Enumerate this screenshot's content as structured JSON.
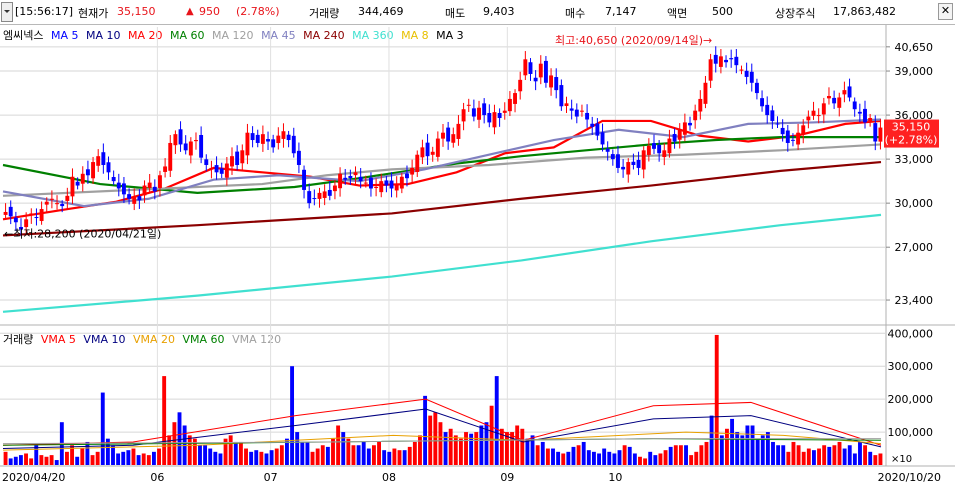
{
  "header": {
    "time": "[15:56:17]",
    "price_label": "현재가",
    "price": "35,150",
    "change_icon": "up-triangle-icon",
    "change_arrow": "▲",
    "change": "950",
    "change_pct": "(2.78%)",
    "volume_label": "거래량",
    "volume": "344,469",
    "sell_label": "매도",
    "sell": "9,403",
    "buy_label": "매수",
    "buy": "7,147",
    "face_label": "액면",
    "face": "500",
    "listed_label": "상장주식",
    "listed": "17,863,482"
  },
  "price_legend": {
    "name": "엠씨넥스",
    "items": [
      {
        "label": "MA 5",
        "color": "#0000ff"
      },
      {
        "label": "MA 10",
        "color": "#000080"
      },
      {
        "label": "MA 20",
        "color": "#ff0000"
      },
      {
        "label": "MA 60",
        "color": "#008000"
      },
      {
        "label": "MA 120",
        "color": "#a0a0a0"
      },
      {
        "label": "MA 45",
        "color": "#8080c0"
      },
      {
        "label": "MA 240",
        "color": "#8b0000"
      },
      {
        "label": "MA 360",
        "color": "#40e0d0"
      },
      {
        "label": "MA 8",
        "color": "#e8c000"
      },
      {
        "label": "MA 3",
        "color": "#000000"
      }
    ]
  },
  "volume_legend": {
    "name": "거래량",
    "items": [
      {
        "label": "VMA 5",
        "color": "#ff0000"
      },
      {
        "label": "VMA 10",
        "color": "#000080"
      },
      {
        "label": "VMA 20",
        "color": "#e8a000"
      },
      {
        "label": "VMA 60",
        "color": "#008000"
      },
      {
        "label": "VMA 120",
        "color": "#a0a0a0"
      }
    ]
  },
  "annotations": {
    "high": "최고:40,650 (2020/09/14일)→",
    "low": "←최저:28,200 (2020/04/21일)",
    "last_price": "35,150",
    "last_pct": "(+2.78%)",
    "vol_unit": "×10"
  },
  "chart_data": [
    {
      "type": "candlestick",
      "title": "엠씨넥스",
      "y_ticks": [
        40650,
        39000,
        36000,
        33000,
        30000,
        27000,
        23400
      ],
      "ylim": [
        21700,
        42000
      ],
      "x_ticks": [
        "2020/04/20",
        "06",
        "07",
        "08",
        "09",
        "10",
        "2020/10/20"
      ],
      "high": 40650,
      "low": 28200,
      "last": 35150,
      "close_series": [
        29400,
        29100,
        28700,
        28200,
        28900,
        29300,
        29000,
        29600,
        30100,
        30300,
        30000,
        29800,
        30500,
        31800,
        31200,
        32000,
        31900,
        32800,
        33200,
        32600,
        32100,
        31500,
        31000,
        30600,
        30300,
        30400,
        30200,
        31200,
        31400,
        30800,
        31900,
        32500,
        34100,
        34700,
        34000,
        33600,
        34200,
        34300,
        33100,
        32600,
        32400,
        32100,
        32000,
        32700,
        33200,
        32600,
        33600,
        34800,
        34300,
        34100,
        34700,
        34200,
        33800,
        34600,
        34900,
        34300,
        33400,
        32600,
        30900,
        30000,
        30300,
        30700,
        30800,
        30500,
        31200,
        32000,
        31600,
        31700,
        32100,
        31500,
        31400,
        31000,
        31100,
        31500,
        31200,
        31000,
        31300,
        31800,
        31700,
        32400,
        33300,
        33800,
        33200,
        33500,
        34400,
        34800,
        34200,
        34700,
        35400,
        36400,
        36700,
        35900,
        36500,
        36000,
        35500,
        36200,
        35800,
        36300,
        37100,
        37500,
        38400,
        39800,
        38800,
        38300,
        39500,
        38200,
        38700,
        37700,
        36600,
        36800,
        36300,
        35900,
        36300,
        35700,
        35200,
        34600,
        34000,
        33500,
        33000,
        32400,
        32300,
        32800,
        32600,
        32400,
        33600,
        33900,
        33700,
        33400,
        33600,
        34400,
        34200,
        35000,
        35500,
        35300,
        36300,
        37100,
        38200,
        39800,
        39500,
        40000,
        39600,
        39800,
        39400,
        39100,
        38600,
        38200,
        37500,
        36600,
        36000,
        35600,
        35400,
        34700,
        34100,
        34300,
        34800,
        35300,
        35900,
        36300,
        36000,
        36800,
        37300,
        36800,
        37200,
        37700,
        37200,
        36400,
        36100,
        35500,
        35800,
        34200,
        35150
      ],
      "ma": [
        {
          "name": "MA 20",
          "color": "#ff0000",
          "points": [
            [
              0,
              28900
            ],
            [
              20,
              29600
            ],
            [
              35,
              30100
            ],
            [
              50,
              31000
            ],
            [
              65,
              32400
            ],
            [
              80,
              32100
            ],
            [
              95,
              31800
            ],
            [
              110,
              31200
            ],
            [
              125,
              31300
            ],
            [
              140,
              32100
            ],
            [
              155,
              33400
            ],
            [
              170,
              33800
            ],
            [
              185,
              35600
            ],
            [
              200,
              35600
            ],
            [
              215,
              34600
            ],
            [
              230,
              34200
            ],
            [
              245,
              34600
            ],
            [
              260,
              35400
            ],
            [
              271,
              35600
            ]
          ]
        },
        {
          "name": "MA 60",
          "color": "#008000",
          "points": [
            [
              0,
              32600
            ],
            [
              30,
              31300
            ],
            [
              60,
              30700
            ],
            [
              90,
              31100
            ],
            [
              110,
              31700
            ],
            [
              125,
              32200
            ],
            [
              140,
              32700
            ],
            [
              160,
              33200
            ],
            [
              180,
              33600
            ],
            [
              200,
              34000
            ],
            [
              220,
              34300
            ],
            [
              240,
              34500
            ],
            [
              271,
              34500
            ]
          ]
        },
        {
          "name": "MA 120",
          "color": "#a0a0a0",
          "points": [
            [
              0,
              30500
            ],
            [
              40,
              30900
            ],
            [
              80,
              31300
            ],
            [
              100,
              31900
            ],
            [
              120,
              32300
            ],
            [
              150,
              32600
            ],
            [
              180,
              33100
            ],
            [
              210,
              33300
            ],
            [
              240,
              33600
            ],
            [
              271,
              34000
            ]
          ]
        },
        {
          "name": "MA 45",
          "color": "#8080c0",
          "points": [
            [
              0,
              30800
            ],
            [
              25,
              29800
            ],
            [
              45,
              30300
            ],
            [
              65,
              31600
            ],
            [
              85,
              31900
            ],
            [
              110,
              31500
            ],
            [
              130,
              32300
            ],
            [
              150,
              33300
            ],
            [
              170,
              34300
            ],
            [
              190,
              35000
            ],
            [
              210,
              34500
            ],
            [
              230,
              35400
            ],
            [
              250,
              35500
            ],
            [
              271,
              35700
            ]
          ]
        },
        {
          "name": "MA 240",
          "color": "#8b0000",
          "points": [
            [
              0,
              27800
            ],
            [
              60,
              28500
            ],
            [
              120,
              29300
            ],
            [
              160,
              30300
            ],
            [
              200,
              31200
            ],
            [
              240,
              32200
            ],
            [
              271,
              32800
            ]
          ]
        },
        {
          "name": "MA 360",
          "color": "#40e0d0",
          "points": [
            [
              0,
              22600
            ],
            [
              60,
              23700
            ],
            [
              120,
              25000
            ],
            [
              160,
              26100
            ],
            [
              200,
              27400
            ],
            [
              240,
              28500
            ],
            [
              271,
              29200
            ]
          ]
        }
      ]
    },
    {
      "type": "bar",
      "title": "거래량",
      "y_ticks": [
        400000,
        300000,
        200000,
        100000
      ],
      "ylim": [
        0,
        410000
      ],
      "unit": "×10",
      "values": [
        40000,
        20000,
        25000,
        30000,
        35000,
        20000,
        60000,
        30000,
        25000,
        30000,
        15000,
        130000,
        40000,
        60000,
        25000,
        50000,
        70000,
        30000,
        40000,
        220000,
        80000,
        60000,
        35000,
        40000,
        45000,
        50000,
        30000,
        35000,
        30000,
        40000,
        50000,
        270000,
        90000,
        130000,
        160000,
        120000,
        90000,
        80000,
        60000,
        60000,
        50000,
        40000,
        35000,
        80000,
        90000,
        70000,
        70000,
        50000,
        40000,
        45000,
        40000,
        35000,
        45000,
        50000,
        60000,
        80000,
        300000,
        100000,
        70000,
        70000,
        40000,
        50000,
        60000,
        55000,
        80000,
        120000,
        100000,
        80000,
        60000,
        60000,
        70000,
        50000,
        60000,
        70000,
        45000,
        40000,
        50000,
        45000,
        45000,
        55000,
        70000,
        90000,
        210000,
        150000,
        160000,
        130000,
        100000,
        110000,
        90000,
        80000,
        100000,
        95000,
        100000,
        120000,
        130000,
        180000,
        270000,
        110000,
        100000,
        100000,
        120000,
        110000,
        80000,
        90000,
        60000,
        70000,
        50000,
        50000,
        40000,
        35000,
        40000,
        55000,
        60000,
        70000,
        45000,
        40000,
        35000,
        50000,
        40000,
        35000,
        45000,
        60000,
        55000,
        35000,
        25000,
        20000,
        40000,
        30000,
        35000,
        45000,
        55000,
        60000,
        60000,
        60000,
        30000,
        40000,
        60000,
        70000,
        150000,
        395000,
        90000,
        110000,
        140000,
        100000,
        90000,
        120000,
        120000,
        80000,
        90000,
        100000,
        70000,
        60000,
        60000,
        40000,
        70000,
        60000,
        40000,
        50000,
        45000,
        50000,
        60000,
        55000,
        60000,
        70000,
        50000,
        60000,
        35000,
        70000,
        60000,
        40000,
        30000,
        35000
      ],
      "vma": [
        {
          "name": "VMA 5",
          "color": "#ff0000",
          "points": [
            [
              0,
              60000
            ],
            [
              40,
              70000
            ],
            [
              90,
              150000
            ],
            [
              130,
              200000
            ],
            [
              160,
              75000
            ],
            [
              200,
              180000
            ],
            [
              230,
              190000
            ],
            [
              270,
              60000
            ]
          ]
        },
        {
          "name": "VMA 10",
          "color": "#000080",
          "points": [
            [
              0,
              50000
            ],
            [
              40,
              60000
            ],
            [
              90,
              120000
            ],
            [
              130,
              170000
            ],
            [
              160,
              70000
            ],
            [
              200,
              140000
            ],
            [
              230,
              150000
            ],
            [
              270,
              55000
            ]
          ]
        },
        {
          "name": "VMA 20",
          "color": "#e8a000",
          "points": [
            [
              0,
              45000
            ],
            [
              60,
              60000
            ],
            [
              120,
              90000
            ],
            [
              160,
              75000
            ],
            [
              210,
              100000
            ],
            [
              240,
              90000
            ],
            [
              270,
              65000
            ]
          ]
        },
        {
          "name": "VMA 60",
          "color": "#008000",
          "points": [
            [
              0,
              60000
            ],
            [
              100,
              70000
            ],
            [
              200,
              80000
            ],
            [
              270,
              75000
            ]
          ]
        },
        {
          "name": "VMA 120",
          "color": "#a0a0a0",
          "points": [
            [
              0,
              65000
            ],
            [
              100,
              70000
            ],
            [
              200,
              80000
            ],
            [
              270,
              80000
            ]
          ]
        }
      ]
    }
  ]
}
